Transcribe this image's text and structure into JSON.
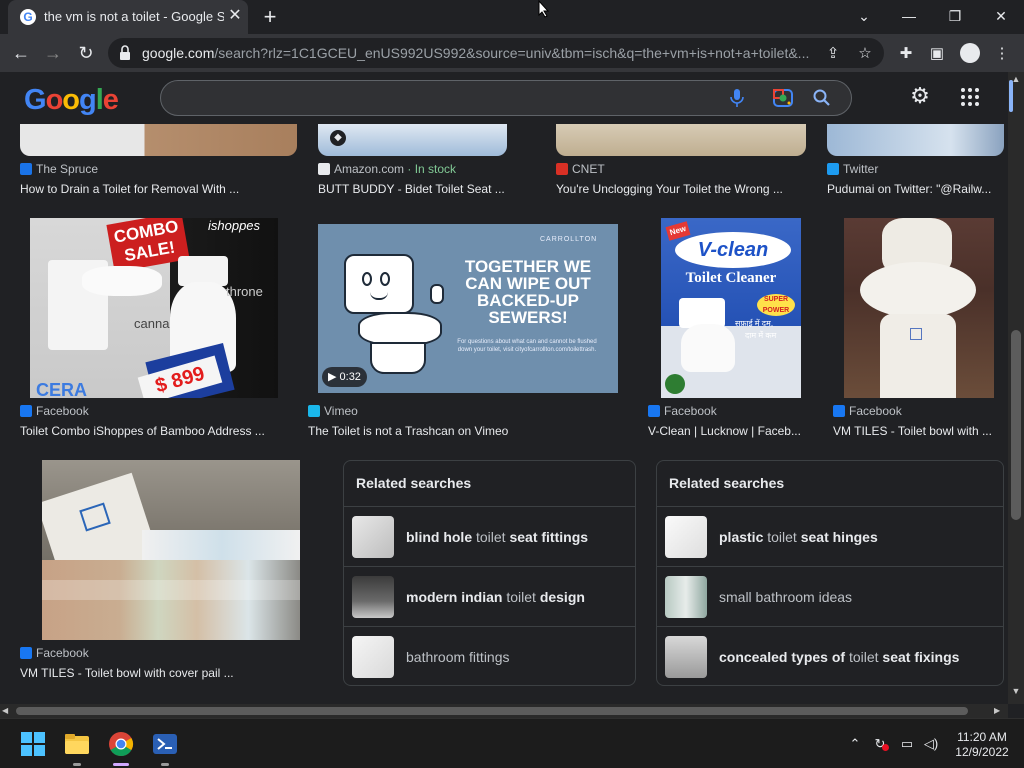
{
  "browser": {
    "tab_title": "the vm is not a toilet - Google Se",
    "url_host": "google.com",
    "url_rest": "/search?rlz=1C1GCEU_enUS992US992&source=univ&tbm=isch&q=the+vm+is+not+a+toilet&..."
  },
  "top_row": [
    {
      "source": "The Spruce",
      "caption": "How to Drain a Toilet for Removal With ...",
      "color": "#1a73e8"
    },
    {
      "source": "Amazon.com",
      "extra": " · In stock",
      "caption": "BUTT BUDDY - Bidet Toilet Seat ...",
      "color": "#e8eaed"
    },
    {
      "source": "CNET",
      "caption": "You're Unclogging Your Toilet the Wrong ...",
      "color": "#d93025"
    },
    {
      "source": "Twitter",
      "caption": "Pudumai on Twitter: \"@Railw...",
      "color": "#1d9bf0"
    }
  ],
  "mid_row": [
    {
      "source": "Facebook",
      "caption": "Toilet Combo iShoppes of Bamboo Address ..."
    },
    {
      "source": "Vimeo",
      "caption": "The Toilet is not a Trashcan on Vimeo",
      "duration": "0:32"
    },
    {
      "source": "Facebook",
      "caption": "V-Clean | Lucknow | Faceb..."
    },
    {
      "source": "Facebook",
      "caption": "VM TILES - Toilet bowl with ..."
    }
  ],
  "bottom_item": {
    "source": "Facebook",
    "caption": "VM TILES - Toilet bowl with cover pail ..."
  },
  "image_text": {
    "combo": {
      "sale": "COMBO SALE!",
      "brand": "ishoppes",
      "throne": "throne",
      "canna": "canna",
      "price": "$ 899",
      "cera": "CERA"
    },
    "vimeo": {
      "org": "CARROLLTON",
      "headline": "TOGETHER WE CAN WIPE OUT BACKED-UP SEWERS!",
      "sub": "For questions about what can and cannot be flushed down your toilet, visit cityofcarrollton.com/toilettrash."
    },
    "vclean": {
      "new": "New",
      "brand": "V-clean",
      "product": "Toilet Cleaner",
      "badge": "SUPER POWER",
      "hindi1": "सफ़ाई में दम,",
      "hindi2": "दाम में कम"
    }
  },
  "related_left": {
    "title": "Related searches",
    "items": [
      {
        "pre": "blind hole",
        "mid": "toilet",
        "post": "seat fittings"
      },
      {
        "pre": "modern indian",
        "mid": "toilet",
        "post": "design"
      },
      {
        "pre": "",
        "mid": "bathroom fittings",
        "post": ""
      }
    ]
  },
  "related_right": {
    "title": "Related searches",
    "items": [
      {
        "pre": "plastic",
        "mid": "toilet",
        "post": "seat hinges"
      },
      {
        "pre": "",
        "mid": "small bathroom ideas",
        "post": ""
      },
      {
        "pre": "concealed types of",
        "mid": "toilet",
        "post": "seat fixings"
      }
    ]
  },
  "taskbar": {
    "time": "11:20 AM",
    "date": "12/9/2022"
  }
}
